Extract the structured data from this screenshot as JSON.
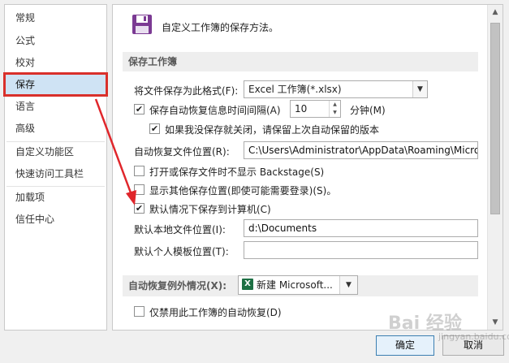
{
  "nav": {
    "items": [
      {
        "label": "常规"
      },
      {
        "label": "公式"
      },
      {
        "label": "校对"
      },
      {
        "label": "保存"
      },
      {
        "label": "语言"
      },
      {
        "label": "高级"
      },
      {
        "label": "自定义功能区"
      },
      {
        "label": "快速访问工具栏"
      },
      {
        "label": "加载项"
      },
      {
        "label": "信任中心"
      }
    ],
    "selected": "保存",
    "highlight_color": "#d9302b"
  },
  "header": {
    "icon": "floppy-disk-icon",
    "title": "自定义工作簿的保存方法。"
  },
  "save_workbook": {
    "section_title": "保存工作簿",
    "format_label": "将文件保存为此格式(F):",
    "format_value": "Excel 工作簿(*.xlsx)",
    "autorecover_label": "保存自动恢复信息时间间隔(A)",
    "autorecover_checked": true,
    "autorecover_minutes": "10",
    "minutes_label": "分钟(M)",
    "keep_last_label": "如果我没保存就关闭，请保留上次自动保留的版本",
    "keep_last_checked": true,
    "autorecover_location_label": "自动恢复文件位置(R):",
    "autorecover_location_value": "C:\\Users\\Administrator\\AppData\\Roaming\\Micro",
    "no_backstage_label": "打开或保存文件时不显示 Backstage(S)",
    "no_backstage_checked": false,
    "show_other_label": "显示其他保存位置(即使可能需要登录)(S)。",
    "show_other_checked": false,
    "default_computer_label": "默认情况下保存到计算机(C)",
    "default_computer_checked": true,
    "default_local_label": "默认本地文件位置(I):",
    "default_local_value": "d:\\Documents",
    "default_template_label": "默认个人模板位置(T):",
    "default_template_value": ""
  },
  "autorecover_exceptions": {
    "label": "自动恢复例外情况(X):",
    "workbook_value": "新建 Microsoft...",
    "excel_icon_letter": "X",
    "disable_label": "仅禁用此工作簿的自动恢复(D)",
    "disable_checked": false
  },
  "footer": {
    "ok_label": "确定",
    "cancel_label": "取消"
  },
  "watermark": {
    "text": "Bai 经验",
    "sub": "jingyan.baidu.com"
  },
  "colors": {
    "selected_bg": "#cfe3f4",
    "annotation_red": "#d9302b"
  }
}
